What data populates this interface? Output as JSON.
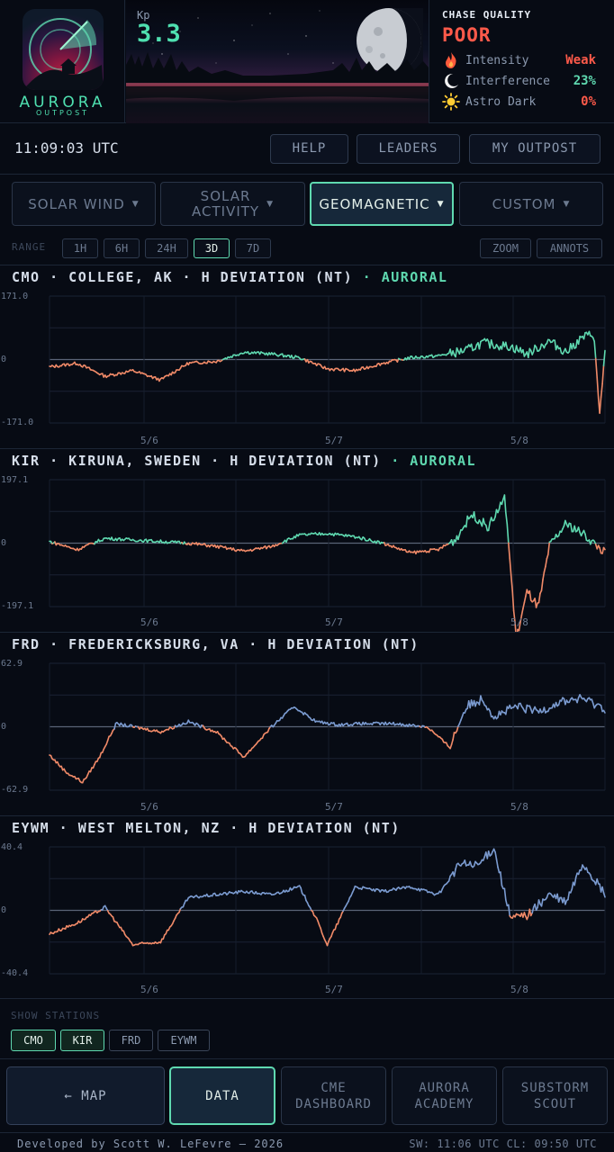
{
  "app": {
    "name": "AURORA",
    "subtitle": "OUTPOST"
  },
  "kp": {
    "label": "Kp",
    "value": "3.3"
  },
  "chase": {
    "title": "CHASE QUALITY",
    "value": "POOR",
    "rows": [
      {
        "icon": "flame-icon",
        "label": "Intensity",
        "value": "Weak",
        "color": "#ff5a4a"
      },
      {
        "icon": "moon-icon",
        "label": "Interference",
        "value": "23%",
        "color": "#5fd9b0"
      },
      {
        "icon": "sun-icon",
        "label": "Astro Dark",
        "value": "0%",
        "color": "#ff5a4a"
      }
    ]
  },
  "clock": "11:09:03 UTC",
  "nav": {
    "help": "HELP",
    "leaders": "LEADERS",
    "outpost": "MY OUTPOST"
  },
  "categories": {
    "solar_wind": "SOLAR WIND",
    "solar_activity_1": "SOLAR",
    "solar_activity_2": "ACTIVITY",
    "geomagnetic": "GEOMAGNETIC",
    "custom": "CUSTOM",
    "arrow": "▼"
  },
  "range": {
    "label": "RANGE",
    "options": [
      "1H",
      "6H",
      "24H",
      "3D",
      "7D"
    ],
    "selected": "3D",
    "zoom": "ZOOM",
    "annots": "ANNOTS"
  },
  "colors": {
    "accent": "#5fd9b0",
    "negative": "#f08a68",
    "blue": "#7b9bd0",
    "alert": "#ff5a4a"
  },
  "chart_data": [
    {
      "type": "line",
      "station": "CMO",
      "title": "CMO · COLLEGE, AK · H DEVIATION (NT)",
      "tag": "· AURORAL",
      "ylim": [
        -171.0,
        171.0
      ],
      "yticks": [
        "171.0",
        "0",
        "-171.0"
      ],
      "xticks": [
        "5/6",
        "5/7",
        "5/8"
      ],
      "palette": "auroral",
      "x": [
        0,
        0.05,
        0.1,
        0.15,
        0.2,
        0.25,
        0.3,
        0.35,
        0.4,
        0.45,
        0.5,
        0.55,
        0.6,
        0.65,
        0.7,
        0.75,
        0.78,
        0.8,
        0.83,
        0.86,
        0.9,
        0.93,
        0.96,
        0.98,
        0.99,
        1.0
      ],
      "y": [
        -20,
        -10,
        -45,
        -30,
        -55,
        -10,
        -5,
        20,
        15,
        5,
        -25,
        -30,
        -10,
        5,
        10,
        25,
        45,
        40,
        35,
        15,
        50,
        20,
        60,
        70,
        -150,
        20
      ]
    },
    {
      "type": "line",
      "station": "KIR",
      "title": "KIR · KIRUNA, SWEDEN · H DEVIATION (NT)",
      "tag": "· AURORAL",
      "ylim": [
        -197.1,
        197.1
      ],
      "yticks": [
        "197.1",
        "0",
        "-197.1"
      ],
      "xticks": [
        "5/6",
        "5/7",
        "5/8"
      ],
      "palette": "auroral",
      "x": [
        0,
        0.05,
        0.1,
        0.15,
        0.2,
        0.25,
        0.3,
        0.35,
        0.4,
        0.45,
        0.5,
        0.55,
        0.6,
        0.65,
        0.7,
        0.73,
        0.76,
        0.79,
        0.82,
        0.84,
        0.86,
        0.88,
        0.9,
        0.93,
        0.96,
        1.0
      ],
      "y": [
        5,
        -20,
        15,
        10,
        5,
        0,
        -10,
        -25,
        -10,
        25,
        30,
        20,
        0,
        -30,
        -20,
        10,
        90,
        50,
        140,
        -300,
        -150,
        -200,
        -10,
        60,
        30,
        -30
      ]
    },
    {
      "type": "line",
      "station": "FRD",
      "title": "FRD · FREDERICKSBURG, VA · H DEVIATION (NT)",
      "tag": "",
      "ylim": [
        -62.9,
        62.9
      ],
      "yticks": [
        "62.9",
        "0",
        "-62.9"
      ],
      "xticks": [
        "5/6",
        "5/7",
        "5/8"
      ],
      "palette": "standard",
      "x": [
        0,
        0.03,
        0.06,
        0.09,
        0.12,
        0.15,
        0.2,
        0.25,
        0.3,
        0.35,
        0.4,
        0.44,
        0.48,
        0.52,
        0.56,
        0.62,
        0.68,
        0.72,
        0.75,
        0.78,
        0.8,
        0.84,
        0.88,
        0.92,
        0.96,
        1.0
      ],
      "y": [
        -28,
        -45,
        -55,
        -30,
        3,
        0,
        -5,
        5,
        -5,
        -30,
        0,
        20,
        5,
        2,
        3,
        3,
        0,
        -20,
        20,
        28,
        10,
        20,
        15,
        25,
        28,
        18
      ]
    },
    {
      "type": "line",
      "station": "EYWM",
      "title": "EYWM · WEST MELTON, NZ · H DEVIATION (NT)",
      "tag": "",
      "ylim": [
        -40.4,
        40.4
      ],
      "yticks": [
        "40.4",
        "0",
        "-40.4"
      ],
      "xticks": [
        "5/6",
        "5/7",
        "5/8"
      ],
      "palette": "standard",
      "x": [
        0,
        0.05,
        0.1,
        0.15,
        0.2,
        0.25,
        0.3,
        0.35,
        0.4,
        0.45,
        0.48,
        0.5,
        0.55,
        0.6,
        0.65,
        0.7,
        0.74,
        0.77,
        0.8,
        0.83,
        0.86,
        0.9,
        0.93,
        0.96,
        0.98,
        1.0
      ],
      "y": [
        -15,
        -8,
        2,
        -22,
        -20,
        8,
        10,
        12,
        10,
        15,
        -5,
        -22,
        15,
        12,
        15,
        10,
        30,
        28,
        40,
        -5,
        -3,
        10,
        5,
        30,
        20,
        10
      ]
    }
  ],
  "stations": {
    "label": "SHOW STATIONS",
    "items": [
      {
        "label": "CMO",
        "on": true
      },
      {
        "label": "KIR",
        "on": true
      },
      {
        "label": "FRD",
        "on": false
      },
      {
        "label": "EYWM",
        "on": false
      }
    ]
  },
  "bottom_nav": {
    "map": "← MAP",
    "data": "DATA",
    "cme_1": "CME",
    "cme_2": "DASHBOARD",
    "academy_1": "AURORA",
    "academy_2": "ACADEMY",
    "scout_1": "SUBSTORM",
    "scout_2": "SCOUT"
  },
  "footer": {
    "credit": "Developed by Scott W. LeFevre — 2026",
    "status": "SW: 11:06 UTC  CL: 09:50 UTC"
  }
}
